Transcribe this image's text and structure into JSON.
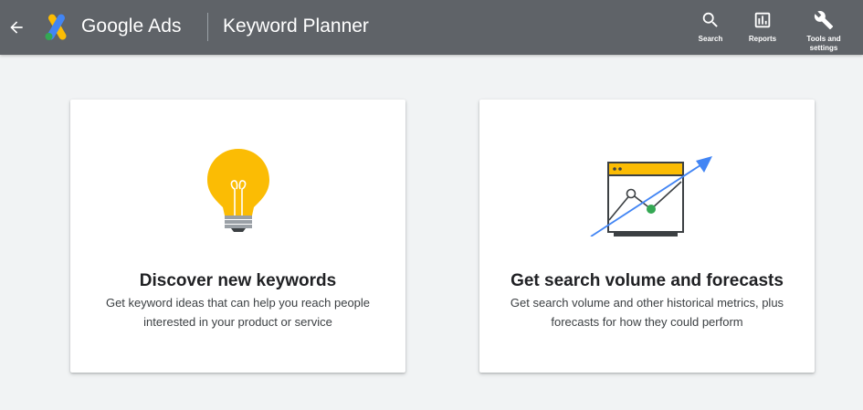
{
  "header": {
    "back_icon": "arrow-left-icon",
    "product_name": "Google Ads",
    "page_title": "Keyword Planner",
    "background_color": "#5f6368",
    "tools": [
      {
        "label": "Search",
        "icon": "search-icon"
      },
      {
        "label": "Reports",
        "icon": "bar-chart-icon"
      },
      {
        "label": "Tools and settings",
        "icon": "wrench-icon"
      }
    ]
  },
  "cards": [
    {
      "title": "Discover new keywords",
      "description": "Get keyword ideas that can help you reach people interested in your product or service",
      "icon": "lightbulb-icon"
    },
    {
      "title": "Get search volume and forecasts",
      "description": "Get search volume and other historical metrics, plus forecasts for how they could perform",
      "icon": "forecast-chart-icon"
    }
  ],
  "colors": {
    "page_background": "#f1f3f4",
    "accent_yellow": "#fbbc04",
    "accent_blue": "#4285f4",
    "accent_green": "#34a853"
  }
}
